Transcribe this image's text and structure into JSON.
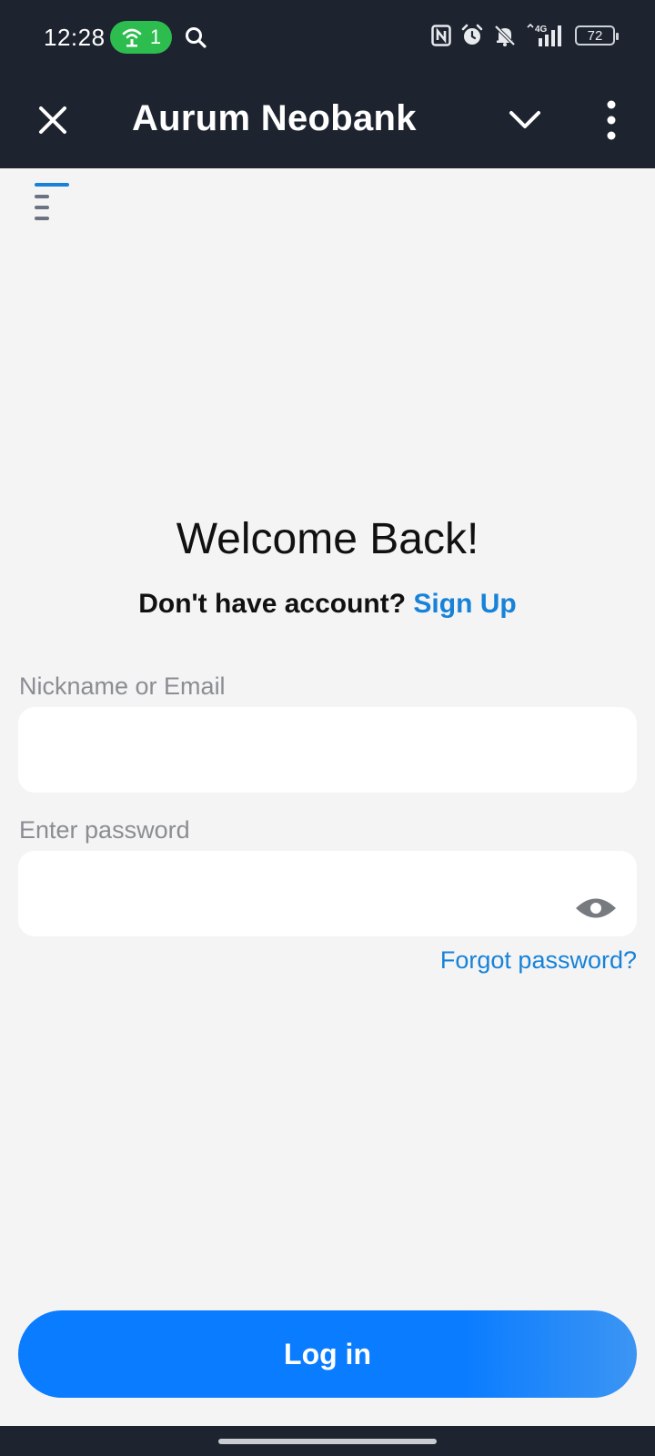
{
  "status_bar": {
    "time": "12:28",
    "hotspot_count": "1",
    "network": "4G",
    "battery": "72"
  },
  "app_bar": {
    "title": "Aurum Neobank"
  },
  "login": {
    "title": "Welcome Back!",
    "signup_prompt": "Don't have account?",
    "signup_link": "Sign Up",
    "email_label": "Nickname or Email",
    "email_value": "",
    "password_label": "Enter password",
    "password_value": "",
    "forgot_link": "Forgot password?",
    "login_button": "Log in"
  },
  "colors": {
    "bar_background": "#1d2430",
    "accent": "#1782d8",
    "button": "#0a7cff",
    "hotspot": "#2dbd4e"
  },
  "icons": [
    "close-icon",
    "chevron-down-icon",
    "more-vertical-icon",
    "menu-icon",
    "eye-icon",
    "search-icon",
    "hotspot-icon",
    "nfc-icon",
    "alarm-icon",
    "bell-off-icon",
    "signal-icon",
    "battery-icon"
  ]
}
